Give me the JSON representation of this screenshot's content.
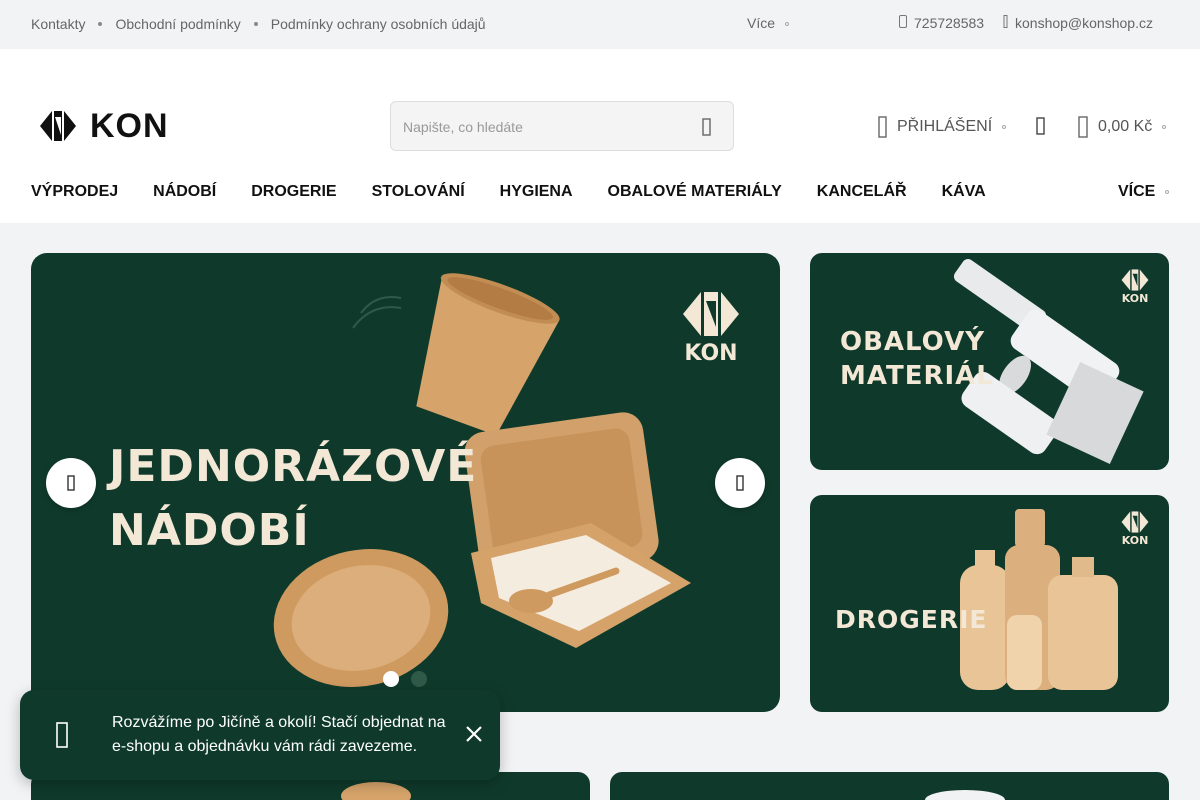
{
  "topbar": {
    "links": [
      "Kontakty",
      "Obchodní podmínky",
      "Podmínky ochrany osobních údajů"
    ],
    "more": "Více",
    "phone": "725728583",
    "email": "konshop@konshop.cz"
  },
  "header": {
    "logo_text": "KON",
    "search_placeholder": "Napište, co hledáte",
    "login_label": "PŘIHLÁŠENÍ",
    "cart_total": "0,00 Kč"
  },
  "nav": {
    "items": [
      "VÝPRODEJ",
      "NÁDOBÍ",
      "DROGERIE",
      "STOLOVÁNÍ",
      "HYGIENA",
      "OBALOVÉ MATERIÁLY",
      "KANCELÁŘ",
      "KÁVA"
    ],
    "more": "VÍCE"
  },
  "banners": {
    "main_title_line1": "JEDNORÁZOVÉ",
    "main_title_line2": "NÁDOBÍ",
    "main_brand": "KON",
    "side1_title_line1": "OBALOVÝ",
    "side1_title_line2": "MATERIÁL",
    "side1_brand": "KON",
    "side2_title": "DROGERIE",
    "side2_brand": "KON"
  },
  "slider": {
    "slide_count": 2,
    "active_index": 0
  },
  "toast": {
    "text": "Rozvážíme po Jičíně a okolí! Stačí objednat na e-shopu a objednávku vám rádi zavezeme."
  },
  "colors": {
    "brand_green": "#0f3a2b",
    "cream": "#f3e7d6",
    "kraft": "#d2a06a"
  },
  "icons": [
    "phone-icon",
    "mail-icon",
    "search-icon",
    "user-icon",
    "heart-icon",
    "cart-icon",
    "chevron-left-icon",
    "chevron-right-icon",
    "truck-icon",
    "close-icon"
  ]
}
